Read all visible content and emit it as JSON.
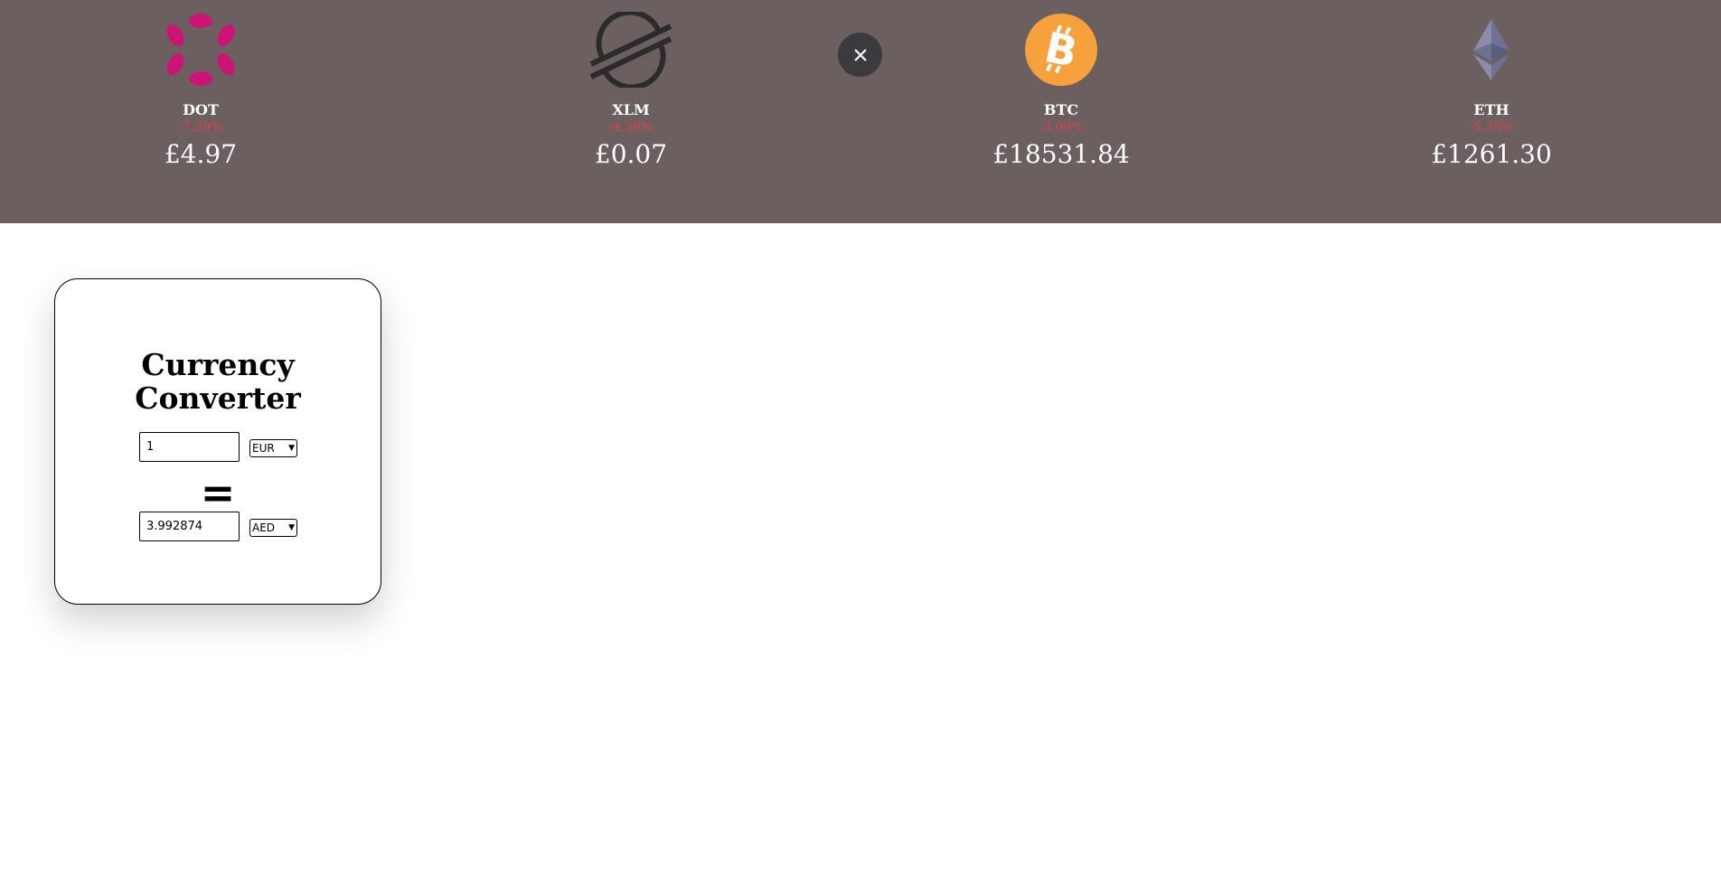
{
  "ticker": [
    {
      "symbol": "DOT",
      "change": "-7.39%",
      "price": "£4.97",
      "icon": "polkadot-logo-icon",
      "color": "#e6007a"
    },
    {
      "symbol": "XLM",
      "change": "-4.38%",
      "price": "£0.07",
      "icon": "stellar-logo-icon",
      "color": "#2b2b2b"
    },
    {
      "symbol": "BTC",
      "change": "-3.09%",
      "price": "£18531.84",
      "icon": "bitcoin-logo-icon",
      "color": "#f7931a"
    },
    {
      "symbol": "ETH",
      "change": "-5.35%",
      "price": "£1261.30",
      "icon": "ethereum-logo-icon",
      "color": "#8a92b2"
    }
  ],
  "close_button": {
    "icon": "close-icon"
  },
  "converter": {
    "title_line1": "Currency",
    "title_line2": "Converter",
    "from": {
      "value": "1",
      "currency": "EUR"
    },
    "equals": "=",
    "to": {
      "value": "3.992874",
      "currency": "AED"
    }
  },
  "colors": {
    "ticker_background": "#6b5f5f",
    "negative_change": "#e0414a",
    "close_button": "#3a3a3f"
  }
}
